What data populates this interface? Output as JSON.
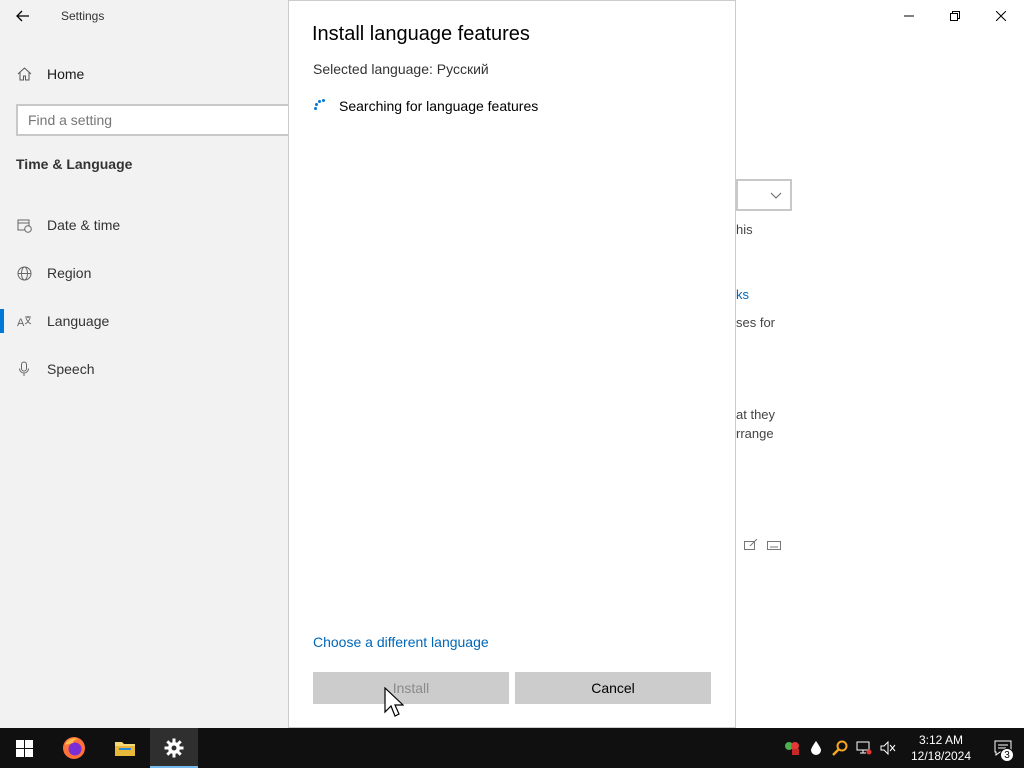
{
  "settings": {
    "app_title": "Settings",
    "home_label": "Home",
    "search_placeholder": "Find a setting",
    "section_title": "Time & Language",
    "nav_items": [
      {
        "label": "Date & time",
        "icon": "calendar-clock-icon"
      },
      {
        "label": "Region",
        "icon": "globe-icon"
      },
      {
        "label": "Language",
        "icon": "language-icon",
        "selected": true
      },
      {
        "label": "Speech",
        "icon": "microphone-icon"
      }
    ],
    "background_fragments": [
      "his",
      "ks",
      "ses for",
      "at they",
      "rrange"
    ]
  },
  "dialog": {
    "title": "Install language features",
    "selected_language": "Selected language: Русский",
    "status": "Searching for language features",
    "choose_link": "Choose a different language",
    "install_label": "Install",
    "install_enabled": false,
    "cancel_label": "Cancel"
  },
  "taskbar": {
    "apps": [
      {
        "name": "start",
        "icon": "windows-logo-icon"
      },
      {
        "name": "firefox",
        "icon": "firefox-icon"
      },
      {
        "name": "file-explorer",
        "icon": "folder-icon"
      },
      {
        "name": "settings",
        "icon": "gear-icon",
        "active": true
      }
    ],
    "time": "3:12 AM",
    "date": "12/18/2024",
    "notification_count": "3"
  },
  "colors": {
    "accent": "#0078d7",
    "link": "#0067b8",
    "nav_bg": "#f2f2f2",
    "button_bg": "#cccccc",
    "taskbar_bg": "#101010"
  }
}
